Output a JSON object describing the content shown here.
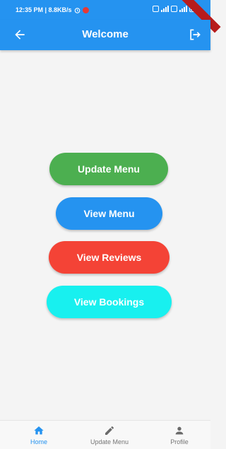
{
  "status_bar": {
    "time_speed": "12:35 PM | 8.8KB/s"
  },
  "app_bar": {
    "title": "Welcome",
    "back_icon": "arrow-left-icon",
    "logout_icon": "logout-icon"
  },
  "menu": {
    "update_menu": "Update Menu",
    "view_menu": "View Menu",
    "view_reviews": "View Reviews",
    "view_bookings": "View Bookings"
  },
  "colors": {
    "primary": "#2593f0",
    "update": "#4caf50",
    "reviews": "#f44336",
    "bookings": "#18f0ef"
  },
  "bottom_nav": {
    "items": [
      {
        "label": "Home",
        "icon": "home-icon",
        "active": true
      },
      {
        "label": "Update Menu",
        "icon": "pencil-icon",
        "active": false
      },
      {
        "label": "Profile",
        "icon": "person-icon",
        "active": false
      }
    ]
  }
}
